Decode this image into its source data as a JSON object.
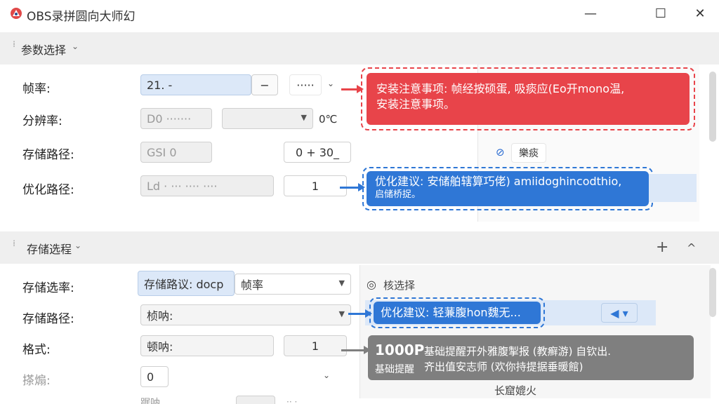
{
  "window": {
    "title": "OBS录拼圆向大师幻",
    "minimize_glyph": "—",
    "maximize_glyph": "☐",
    "close_glyph": "✕"
  },
  "section1": {
    "title": "参数选择",
    "rows": [
      {
        "label": "帧率:"
      },
      {
        "label": "分辨率:"
      },
      {
        "label": "存储路径:"
      },
      {
        "label": "优化路径:"
      }
    ],
    "fps_value": "21. -",
    "fps_minus": "−",
    "fps_more": "·····",
    "resolution_value": "D0 ·······",
    "resolution_unit": "0℃",
    "storage_value": "GSI 0",
    "storage_range": "0 + 30_",
    "optimize_value": "Ld ·  ··· ···· ····",
    "optimize_count": "1"
  },
  "callouts": {
    "red_line1": "安装注意事项: 帧经按硕蛋, 吸痰应(Eo开mono温,",
    "red_line2": "安装注意事项。",
    "blue1_line1": "优化建议: 安储舶辖算巧佬) amiidoghincodthio,",
    "blue1_line2": "启储桥捉。",
    "blue2_text": "优化建议: 轻蒹腹hon魏无...",
    "gray_big": "1000P",
    "gray_sub": "基础提醒",
    "gray_line1": "基础提醒开外雅腹掣报 (教癣游) 自钦出.",
    "gray_line2": "齐出值安志师 (欢你持提据垂暖館)"
  },
  "side1": {
    "item_text": "樂痰"
  },
  "section2": {
    "title": "存储选程",
    "add_glyph": "+",
    "collapse_glyph": "^",
    "rows": [
      {
        "label": "存储选率:"
      },
      {
        "label": "存储路径:"
      },
      {
        "label": "格式:"
      },
      {
        "label": "搽煽:"
      }
    ],
    "storage_sel_prefix": "存储路议: docp",
    "storage_sel_value": "帧率",
    "path_value": "桢呐:",
    "format_value": "顿呐:",
    "format_count": "1",
    "extra_value": "0",
    "bottom_label": "踞呐"
  },
  "side2": {
    "header": "核选择",
    "footer": "长窟媲火"
  }
}
